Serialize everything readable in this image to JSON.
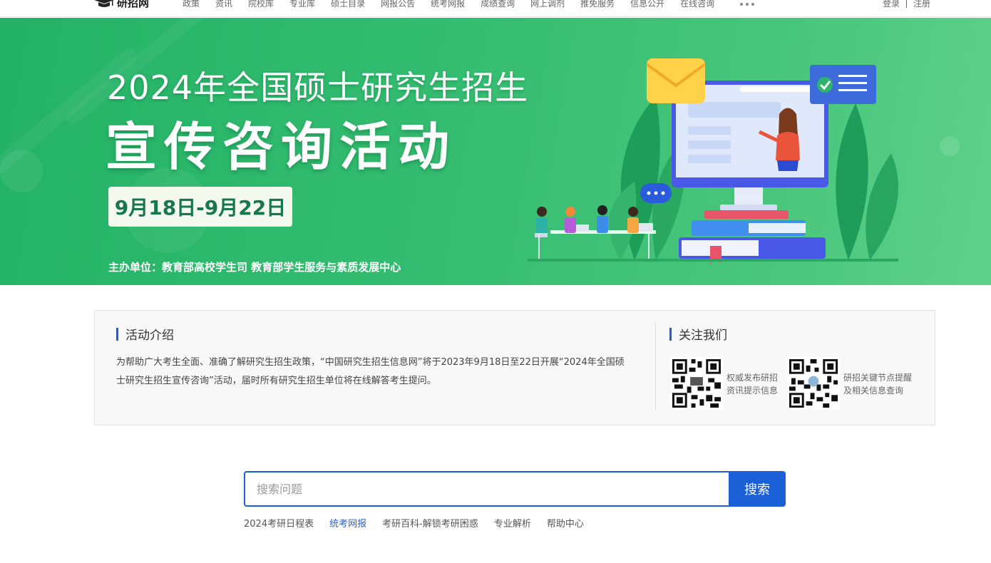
{
  "nav": {
    "logo_text": "研招网",
    "items": [
      "政策",
      "资讯",
      "院校库",
      "专业库",
      "硕士目录",
      "网报公告",
      "统考网报",
      "成绩查询",
      "网上调剂",
      "推免服务",
      "信息公开",
      "在线咨询"
    ],
    "more_icon": "ellipsis-icon",
    "login": "登录",
    "register": "注册"
  },
  "banner": {
    "title_line1": "2024年全国硕士研究生招生",
    "title_line2": "宣传咨询活动",
    "date_range": "9月18日-9月22日",
    "sponsor": "主办单位：教育部高校学生司  教育部学生服务与素质发展中心"
  },
  "intro": {
    "title": "活动介绍",
    "text": "为帮助广大考生全面、准确了解研究生招生政策，“中国研究生招生信息网”将于2023年9月18日至22日开展“2024年全国硕士研究生招生宣传咨询”活动，届时所有研究生招生单位将在线解答考生提问。",
    "follow_title": "关注我们",
    "qr_codes": [
      {
        "label_line1": "权威发布研招",
        "label_line2": "资讯提示信息"
      },
      {
        "label_line1": "研招关键节点提醒",
        "label_line2": "及相关信息查询"
      }
    ]
  },
  "search": {
    "placeholder": "搜索问题",
    "button": "搜索",
    "hot_links": [
      "2024考研日程表",
      "统考网报",
      "考研百科-解锁考研困惑",
      "专业解析",
      "帮助中心"
    ],
    "active_link_index": 1
  },
  "colors": {
    "accent_blue": "#1b5fd6",
    "banner_green": "#2db56b",
    "date_text_green": "#17764a"
  }
}
